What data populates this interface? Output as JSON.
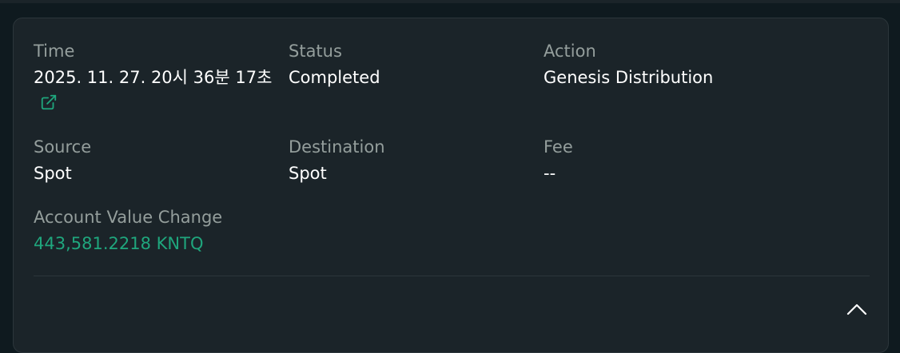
{
  "transaction": {
    "time_label": "Time",
    "time_value": "2025. 11. 27. 20시 36분 17초",
    "status_label": "Status",
    "status_value": "Completed",
    "action_label": "Action",
    "action_value": "Genesis Distribution",
    "source_label": "Source",
    "source_value": "Spot",
    "destination_label": "Destination",
    "destination_value": "Spot",
    "fee_label": "Fee",
    "fee_value": "--",
    "account_change_label": "Account Value Change",
    "account_change_value": "443,581.2218 KNTQ"
  },
  "icons": {
    "external_link": "external-link-icon",
    "collapse": "chevron-up-icon"
  },
  "colors": {
    "background": "#1b2429",
    "label": "#949e9c",
    "value": "#ffffff",
    "positive": "#1fa67d"
  }
}
